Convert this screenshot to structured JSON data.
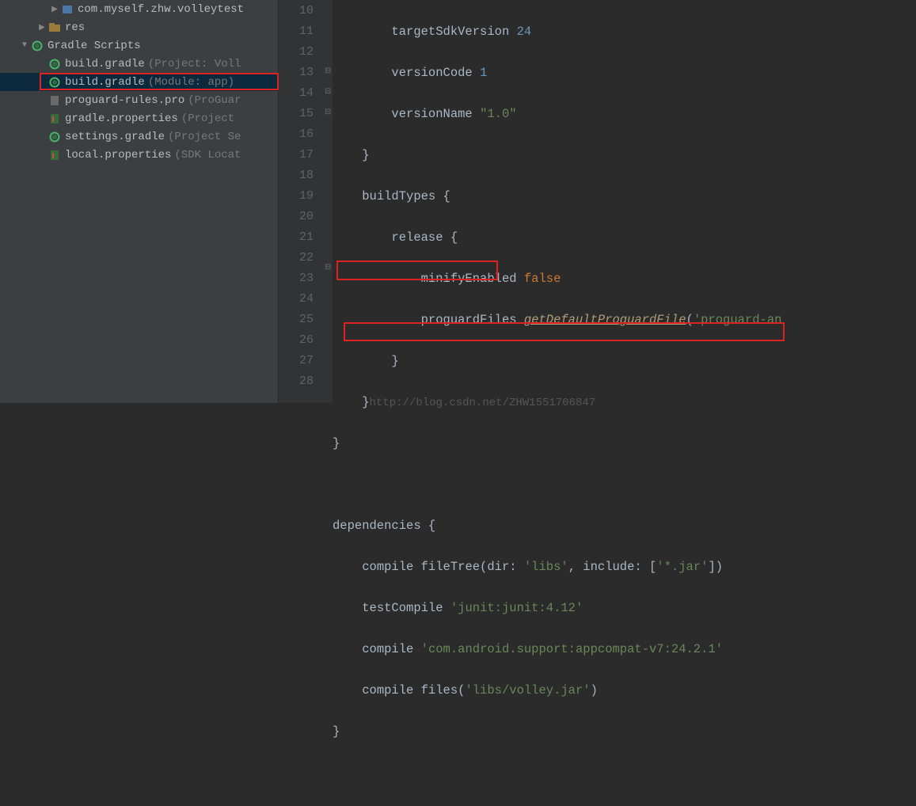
{
  "tree": {
    "pkg": "com.myself.zhw.volleytest",
    "res": "res",
    "scripts_label": "Gradle Scripts",
    "items": [
      {
        "label": "build.gradle",
        "hint": "(Project: Voll"
      },
      {
        "label": "build.gradle",
        "hint": "(Module: app)"
      },
      {
        "label": "proguard-rules.pro",
        "hint": "(ProGuar"
      },
      {
        "label": "gradle.properties",
        "hint": "(Project"
      },
      {
        "label": "settings.gradle",
        "hint": "(Project Se"
      },
      {
        "label": "local.properties",
        "hint": "(SDK Locat"
      }
    ]
  },
  "code": {
    "targetSdkVersion": "targetSdkVersion",
    "targetSdkVersion_v": "24",
    "versionCode": "versionCode",
    "versionCode_v": "1",
    "versionName": "versionName",
    "versionName_v": "\"1.0\"",
    "brace_close1": "}",
    "buildTypes": "buildTypes {",
    "release": "release {",
    "minifyEnabled": "minifyEnabled",
    "false": "false",
    "proguardFiles": "proguardFiles",
    "getDefaultProguardFile": "getDefaultProguardFile",
    "proguardStr": "'proguard-an",
    "brace_close2": "}",
    "brace_close3": "}",
    "watermark": "http://blog.csdn.net/ZHW1551706847",
    "brace_close4": "}",
    "dependencies": "dependencies {",
    "compile1a": "compile fileTree(dir:",
    "compile1b": "'libs'",
    "compile1c": ", include: [",
    "compile1d": "'*.jar'",
    "compile1e": "])",
    "testCompile": "testCompile",
    "junit": "'junit:junit:4.12'",
    "compile2": "compile",
    "appcompat": "'com.android.support:appcompat-v7:24.2.1'",
    "compile3": "compile files(",
    "volley": "'libs/volley.jar'",
    "paren": ")",
    "brace_close5": "}"
  },
  "gutter": [
    "10",
    "11",
    "12",
    "13",
    "14",
    "15",
    "16",
    "17",
    "18",
    "19",
    "20",
    "21",
    "22",
    "23",
    "24",
    "25",
    "26",
    "27",
    "28"
  ]
}
